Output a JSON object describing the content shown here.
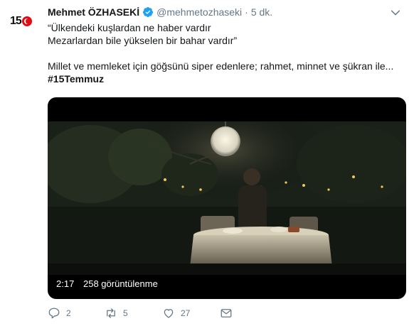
{
  "avatar": {
    "number": "15"
  },
  "author": {
    "name": "Mehmet ÖZHASEKİ",
    "handle": "@mehmetozhaseki",
    "separator": "·",
    "time": "5 dk."
  },
  "tweet": {
    "lines": [
      "“Ülkendeki kuşlardan ne haber vardır",
      "Mezarlardan bile yükselen bir bahar vardır”",
      "Millet ve memleket için göğsünü siper edenlere; rahmet, minnet ve şükran ile...",
      "#15Temmuz"
    ]
  },
  "video": {
    "duration": "2:17",
    "views": "258 görüntülenme"
  },
  "actions": {
    "reply_count": "2",
    "retweet_count": "5",
    "like_count": "27"
  },
  "icons": {
    "verified": "verified-badge-icon",
    "caret": "chevron-down-icon",
    "reply": "reply-icon",
    "retweet": "retweet-icon",
    "like": "heart-icon",
    "dm": "envelope-icon"
  },
  "colors": {
    "verified": "#1da1f2",
    "secondary_text": "#657786",
    "flag_red": "#e30a17"
  }
}
